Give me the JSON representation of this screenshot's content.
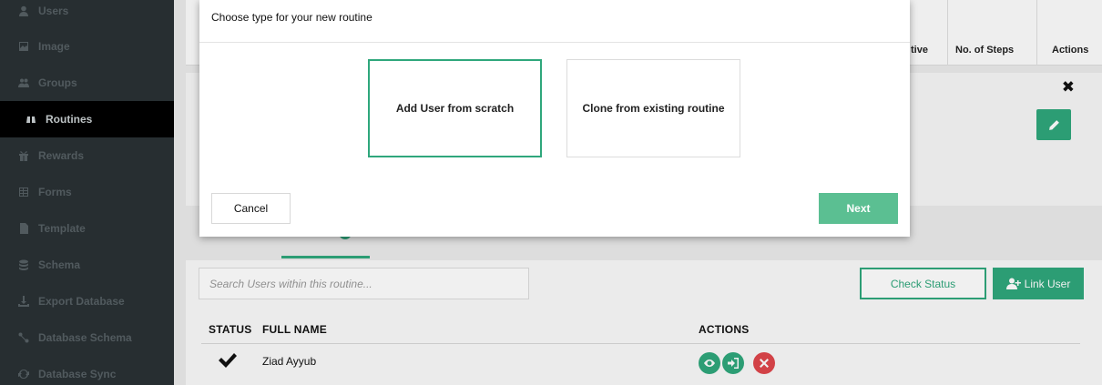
{
  "sidebar": {
    "items": [
      {
        "label": "Users",
        "icon": "user-icon"
      },
      {
        "label": "Image",
        "icon": "image-icon"
      },
      {
        "label": "Groups",
        "icon": "groups-icon"
      },
      {
        "label": "Routines",
        "icon": "binoculars-icon",
        "active": true
      },
      {
        "label": "Rewards",
        "icon": "gift-icon"
      },
      {
        "label": "Forms",
        "icon": "table-icon"
      },
      {
        "label": "Template",
        "icon": "file-icon"
      },
      {
        "label": "Schema",
        "icon": "database-icon"
      },
      {
        "label": "Export Database",
        "icon": "download-icon"
      },
      {
        "label": "Database Schema",
        "icon": "schema-icon"
      },
      {
        "label": "Database Sync",
        "icon": "sync-icon"
      }
    ]
  },
  "background": {
    "table_headers": {
      "active_partial": "tive",
      "steps": "No. of Steps",
      "actions": "Actions"
    },
    "search_placeholder": "Search Users within this routine...",
    "check_status": "Check Status",
    "link_user": "Link User",
    "columns": {
      "status": "STATUS",
      "full_name": "FULL NAME",
      "actions": "ACTIONS"
    },
    "rows": [
      {
        "name": "Ziad Ayyub"
      }
    ]
  },
  "modal": {
    "subtitle": "Choose type for your new routine",
    "options": [
      {
        "label": "Add User from scratch",
        "selected": true
      },
      {
        "label": "Clone from existing routine",
        "selected": false
      }
    ],
    "cancel": "Cancel",
    "next": "Next"
  },
  "colors": {
    "accent": "#2fa77c",
    "next": "#5bbf92",
    "danger": "#e0474c",
    "sidebar": "#2a3135"
  }
}
